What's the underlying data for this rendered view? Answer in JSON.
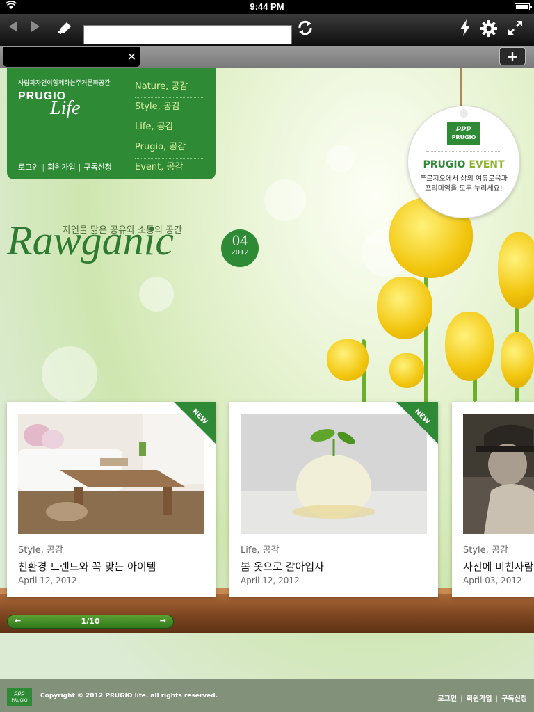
{
  "statusbar": {
    "time": "9:44 PM"
  },
  "browser": {
    "url_value": "",
    "icons": [
      "back-arrow-icon",
      "forward-arrow-icon",
      "bookmark-add-icon",
      "reload-icon",
      "flash-icon",
      "gear-icon",
      "fullscreen-icon",
      "close-icon",
      "plus-icon"
    ]
  },
  "nav": {
    "tagline": "사람과자연이함께하는주거문화공간",
    "brand": "PRUGIO",
    "brand_script": "Life",
    "login": "로그인",
    "signup": "회원가입",
    "subscribe": "구독신청",
    "menu": [
      {
        "label": "Nature, 공감"
      },
      {
        "label": "Style, 공감"
      },
      {
        "label": "Life, 공감"
      },
      {
        "label": "Prugio, 공감"
      },
      {
        "label": "Event, 공감"
      }
    ]
  },
  "event": {
    "logo": "PRUGIO",
    "title_main": "PRUGIO",
    "title_accent": "EVENT",
    "desc": "푸르지오에서 삶의 여유로움과 프리미엄을 모두 누리세요!"
  },
  "hero": {
    "subtitle": "자연을 닮은 공유와 소통의 공간",
    "title": "Rawganic",
    "issue_num": "04",
    "issue_year": "2012"
  },
  "cards": [
    {
      "category": "Style, 공감",
      "title": "친환경 트랜드와 꼭 맞는 아이템",
      "date": "April 12, 2012",
      "badge": "NEW"
    },
    {
      "category": "Life, 공감",
      "title": "봄 옷으로 갈아입자",
      "date": "April 12, 2012",
      "badge": "NEW"
    },
    {
      "category": "Style, 공감",
      "title": "사진에 미친사람",
      "date": "April 03, 2012",
      "badge": ""
    }
  ],
  "pager": {
    "prev": "←",
    "count": "1/10",
    "next": "→"
  },
  "footer": {
    "logo": "PRUGIO",
    "copyright": "Copyright © 2012 PRUGIO life. all rights reserved.",
    "login": "로그인",
    "signup": "회원가입",
    "subscribe": "구독신청"
  },
  "colors": {
    "brand_green": "#2f8a36",
    "accent_lime": "#8bb02a",
    "shelf_wood": "#7b4520"
  }
}
